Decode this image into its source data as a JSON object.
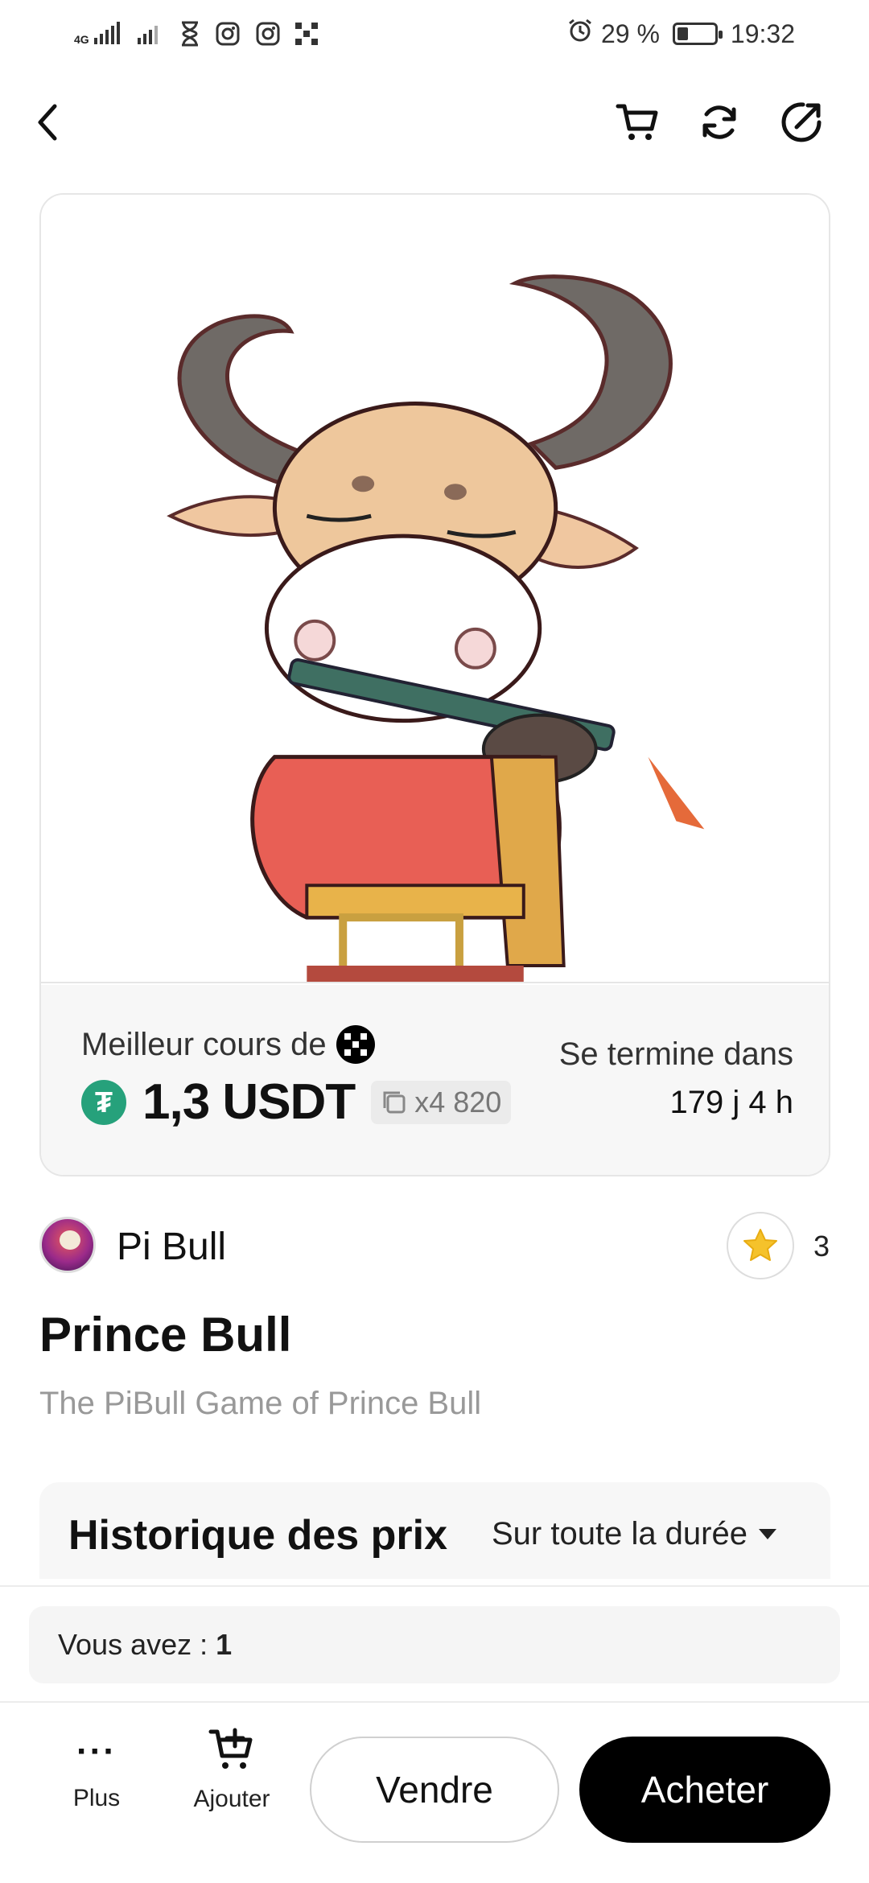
{
  "status_bar": {
    "network_1": "4G",
    "battery_percent_label": "29 %",
    "battery_level": 0.29,
    "time": "19:32",
    "icons": [
      "signal-icon",
      "signal-icon",
      "hourglass-icon",
      "instagram-icon",
      "instagram-icon",
      "okx-icon",
      "alarm-icon",
      "battery-icon"
    ]
  },
  "nav": {
    "icons": [
      "back-icon",
      "cart-icon",
      "refresh-icon",
      "share-icon"
    ]
  },
  "nft": {
    "image_name": "prince-bull-artwork",
    "best_price_label": "Meilleur cours de",
    "currency_icon": "usdt-icon",
    "price": "1,3 USDT",
    "quantity": "x4 820",
    "ends_label": "Se termine dans",
    "ends_value": "179 j 4 h"
  },
  "collection": {
    "name": "Pi Bull",
    "favorites": "3"
  },
  "title": "Prince Bull",
  "description": "The PiBull Game of Prince Bull",
  "history": {
    "title": "Historique des prix",
    "filter": "Sur toute la durée"
  },
  "footer": {
    "owned_label": "Vous avez :",
    "owned_value": "1",
    "more_icon": "···",
    "more_label": "Plus",
    "add_label": "Ajouter",
    "sell_label": "Vendre",
    "buy_label": "Acheter"
  },
  "colors": {
    "usdt": "#26a17b",
    "star": "#f5c22b",
    "buy_button": "#000000"
  }
}
